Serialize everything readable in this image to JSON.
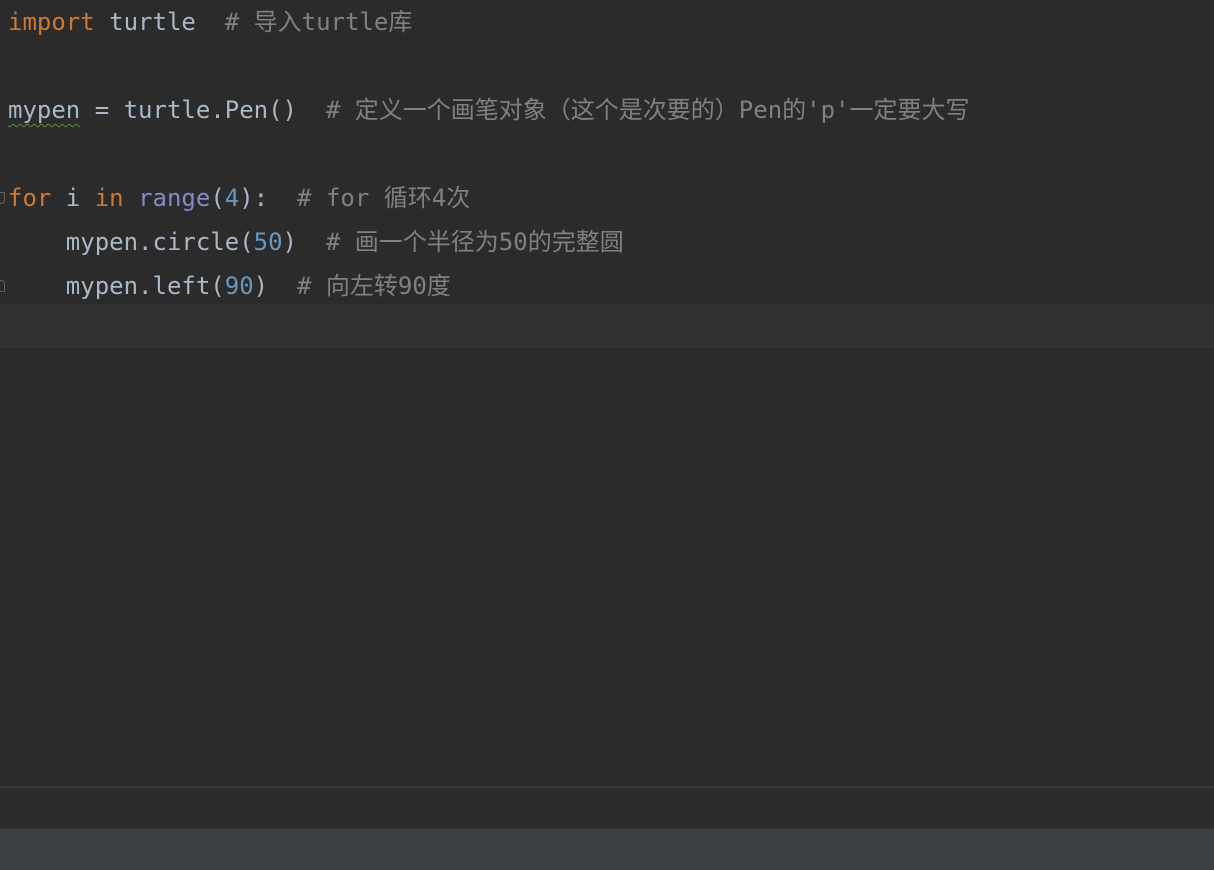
{
  "editor": {
    "lines": {
      "l1": {
        "kw_import": "import",
        "module": "turtle",
        "comment": "# 导入turtle库"
      },
      "l3": {
        "var": "mypen",
        "assign": " = ",
        "call": "turtle.Pen()",
        "comment": "# 定义一个画笔对象（这个是次要的）Pen的'p'一定要大写"
      },
      "l5": {
        "kw_for": "for",
        "loopvar": " i ",
        "kw_in": "in",
        "builtin": "range",
        "open_paren": "(",
        "arg": "4",
        "close": "):",
        "comment": "# for 循环4次"
      },
      "l6": {
        "call": "mypen.circle(",
        "arg": "50",
        "close": ")",
        "comment": "# 画一个半径为50的完整圆"
      },
      "l7": {
        "call": "mypen.left(",
        "arg": "90",
        "close": ")",
        "comment": "# 向左转90度"
      }
    }
  },
  "colors": {
    "background": "#2b2b2b",
    "keyword": "#cc7832",
    "builtin": "#8888c6",
    "number": "#6897bb",
    "comment": "#808080",
    "identifier": "#a9b7c6",
    "current_line": "#323232"
  },
  "icons": {
    "fold_open": "fold-open-icon",
    "fold_close": "fold-close-icon"
  }
}
